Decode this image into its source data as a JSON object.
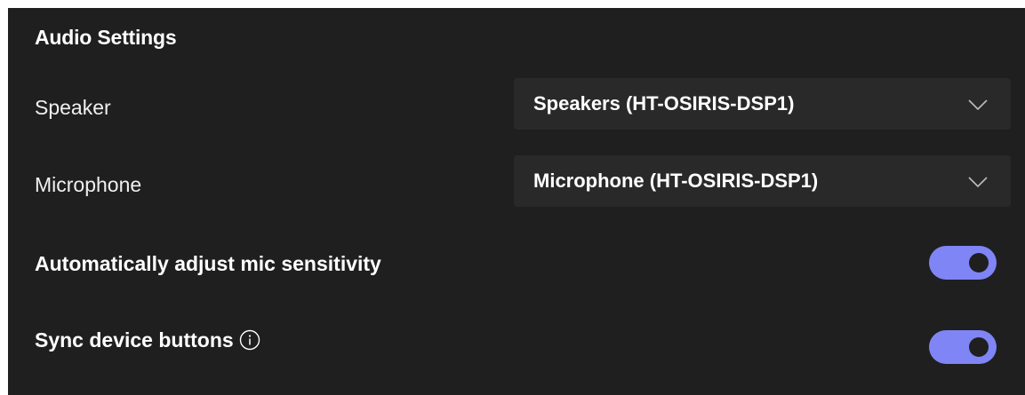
{
  "panel": {
    "title": "Audio Settings"
  },
  "speaker": {
    "label": "Speaker",
    "selected": "Speakers (HT-OSIRIS-DSP1)"
  },
  "microphone": {
    "label": "Microphone",
    "selected": "Microphone (HT-OSIRIS-DSP1)"
  },
  "auto_adjust": {
    "label": "Automatically adjust mic sensitivity",
    "enabled": true
  },
  "sync_buttons": {
    "label": "Sync device buttons",
    "info_icon": "info-icon",
    "enabled": true
  },
  "colors": {
    "background": "#1f1f1f",
    "dropdown_bg": "#292929",
    "toggle_accent": "#7f85f5"
  }
}
